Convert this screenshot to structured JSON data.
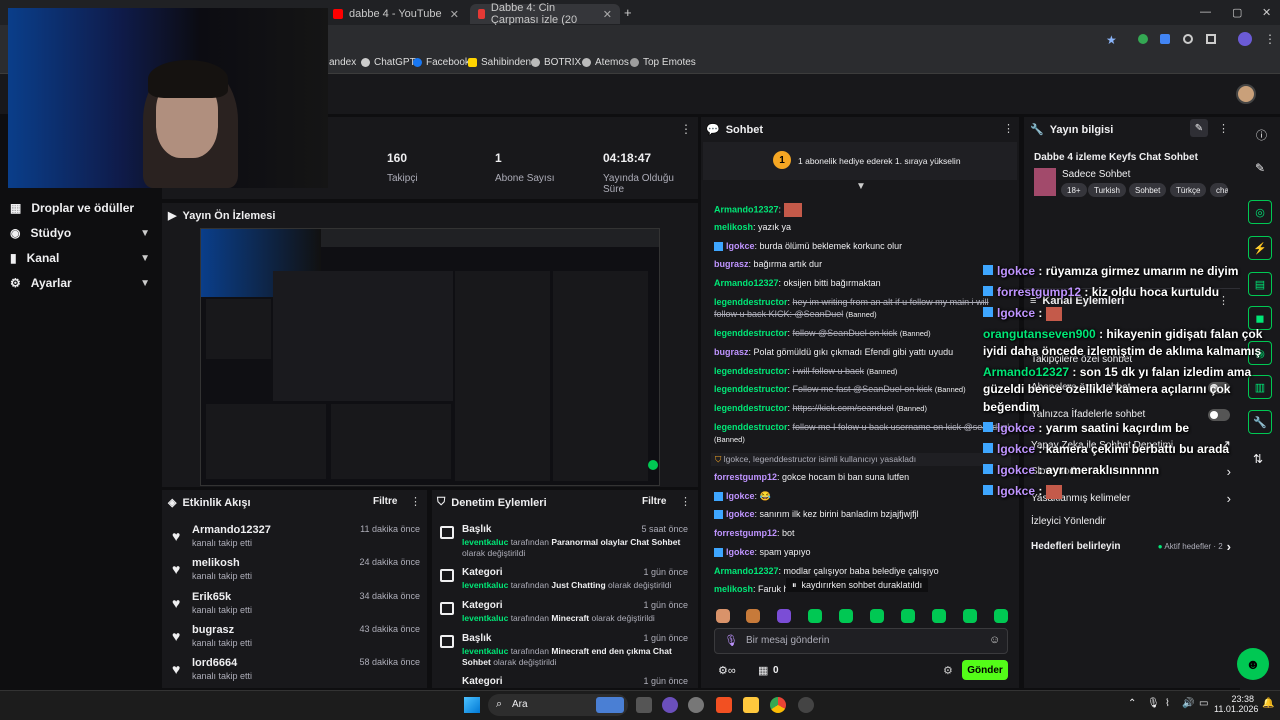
{
  "browser": {
    "tabs": [
      {
        "title": "dabbe 4 - YouTube",
        "color": "#ff0000"
      },
      {
        "title": "Dabbe 4: Cin Çarpması izle (20",
        "color": "#e53935"
      }
    ],
    "bookmarks": [
      "andex",
      "ChatGPT",
      "Facebook",
      "Sahibinden",
      "BOTRIX",
      "Atemos",
      "Top Emotes"
    ],
    "new_tab": "+"
  },
  "sidebar": {
    "items": [
      {
        "label": "Droplar ve ödüller",
        "icon": "gift-icon"
      },
      {
        "label": "Stüdyo",
        "icon": "studio-icon",
        "chevron": "▼"
      },
      {
        "label": "Kanal",
        "icon": "channel-icon",
        "chevron": "▼"
      },
      {
        "label": "Ayarlar",
        "icon": "gear-icon",
        "chevron": "▼"
      }
    ]
  },
  "stats": [
    {
      "value": "160",
      "label": "Takipçi"
    },
    {
      "value": "1",
      "label": "Abone Sayısı"
    },
    {
      "value": "04:18:47",
      "label": "Yayında Olduğu Süre"
    }
  ],
  "preview": {
    "title": "Yayın Ön İzlemesi"
  },
  "activity": {
    "title": "Etkinlik Akışı",
    "filter": "Filtre",
    "items": [
      {
        "name": "Armando12327",
        "action": "kanalı takip etti",
        "time": "11 dakika önce"
      },
      {
        "name": "melikosh",
        "action": "kanalı takip etti",
        "time": "24 dakika önce"
      },
      {
        "name": "Erik65k",
        "action": "kanalı takip etti",
        "time": "34 dakika önce"
      },
      {
        "name": "bugrasz",
        "action": "kanalı takip etti",
        "time": "43 dakika önce"
      },
      {
        "name": "lord6664",
        "action": "kanalı takip etti",
        "time": "58 dakika önce"
      }
    ]
  },
  "moderation": {
    "title": "Denetim Eylemleri",
    "filter": "Filtre",
    "items": [
      {
        "title": "Başlık",
        "time": "5 saat önce",
        "user": "leventkaluc",
        "mid": "tarafından",
        "value": "Paranormal olaylar Chat Sohbet",
        "suffix": "olarak değiştirildi"
      },
      {
        "title": "Kategori",
        "time": "1 gün önce",
        "user": "leventkaluc",
        "mid": "tarafından",
        "value": "Just Chatting",
        "suffix": "olarak değiştirildi"
      },
      {
        "title": "Kategori",
        "time": "1 gün önce",
        "user": "leventkaluc",
        "mid": "tarafından",
        "value": "Minecraft",
        "suffix": "olarak değiştirildi"
      },
      {
        "title": "Başlık",
        "time": "1 gün önce",
        "user": "leventkaluc",
        "mid": "tarafından",
        "value": "Minecraft end den çıkma Chat Sohbet",
        "suffix": "olarak değiştirildi"
      },
      {
        "title": "Kategori",
        "time": "1 gün önce",
        "user": "",
        "mid": "",
        "value": "",
        "suffix": ""
      }
    ]
  },
  "chat": {
    "title": "Sohbet",
    "gift_text": "1 abonelik hediye ederek 1. sıraya yükselin",
    "gift_badge": "1",
    "lines": [
      {
        "user": "Armando12327",
        "color": "#00e676",
        "text": "",
        "emote": true
      },
      {
        "user": "melikosh",
        "color": "#00e676",
        "text": "yazık ya"
      },
      {
        "user": "lgokce",
        "color": "#bf94ff",
        "text": "burda ölümü beklemek korkunc olur",
        "badge": true
      },
      {
        "user": "bugrasz",
        "color": "#bf94ff",
        "text": "bağırma artık dur"
      },
      {
        "user": "Armando12327",
        "color": "#00e676",
        "text": "oksijen bitti bağırmaktan"
      },
      {
        "user": "legenddestructor",
        "color": "#00e676",
        "text": "hey im writing from an alt if u follow my main i will follow u back KICK: @SeanDuel",
        "banned": "(Banned)",
        "strike": true
      },
      {
        "user": "legenddestructor",
        "color": "#00e676",
        "text": "follow @SeanDuel on kick",
        "banned": "(Banned)",
        "strike": true
      },
      {
        "user": "bugrasz",
        "color": "#bf94ff",
        "text": "Polat gömüldü gıkı çıkmadı Efendi gibi yattı uyudu"
      },
      {
        "user": "legenddestructor",
        "color": "#00e676",
        "text": "i will follow u back",
        "banned": "(Banned)",
        "strike": true
      },
      {
        "user": "legenddestructor",
        "color": "#00e676",
        "text": "Follow me fast @SeanDuel on kick",
        "banned": "(Banned)",
        "strike": true
      },
      {
        "user": "legenddestructor",
        "color": "#00e676",
        "text": "https://kick.com/seanduel",
        "banned": "(Banned)",
        "strike": true
      },
      {
        "user": "legenddestructor",
        "color": "#00e676",
        "text": "follow me I folow u back username on kick @seanduel",
        "banned": "(Banned)",
        "strike": true
      }
    ],
    "system": "lgokce, legenddestructor isimli kullanıcıyı yasakladı",
    "lines2": [
      {
        "user": "forrestgump12",
        "color": "#bf94ff",
        "text": "gokce hocam bi ban suna lutfen"
      },
      {
        "user": "lgokce",
        "color": "#bf94ff",
        "text": "😂",
        "badge": true
      },
      {
        "user": "lgokce",
        "color": "#bf94ff",
        "text": "sanırım ilk kez birini banladım bzjajfjwjfjl",
        "badge": true
      },
      {
        "user": "forrestgump12",
        "color": "#bf94ff",
        "text": "bot"
      },
      {
        "user": "lgokce",
        "color": "#bf94ff",
        "text": "spam yapıyo",
        "badge": true
      },
      {
        "user": "Armando12327",
        "color": "#00e676",
        "text": "modlar çalışıyor baba belediye çalışıyo"
      },
      {
        "user": "melikosh",
        "color": "#00e676",
        "text": "Faruk h"
      }
    ],
    "paused": "kaydırırken sohbet duraklatıldı",
    "input_placeholder": "Bir mesaj gönderin",
    "points": "0",
    "send": "Gönder"
  },
  "stream_info": {
    "title": "Yayın bilgisi",
    "stream_title": "Dabbe 4 izleme Keyfs Chat Sohbet",
    "category": "Sadece Sohbet",
    "tags": [
      "18+",
      "Turkish",
      "Sohbet",
      "Türkçe",
      "cha"
    ],
    "channel_actions": "Kanal Eylemleri",
    "items": [
      {
        "label": "Takipçilere özel sohbet",
        "toggle": false
      },
      {
        "label": "Abonelere özel sohbet",
        "toggle": false
      },
      {
        "label": "Yalnızca İfadelerle sohbet",
        "toggle": false
      },
      {
        "label": "Yapay Zeka ile Sohbet Denetimi",
        "arrow": "↗"
      },
      {
        "label": "Slow mode",
        "arrow": "›"
      },
      {
        "label": "Yasaklanmış kelimeler",
        "arrow": "›"
      },
      {
        "label": "İzleyici Yönlendir",
        "arrow": ""
      },
      {
        "label": "Hedefleri belirleyin",
        "arrow": "›",
        "extra": "Aktif hedefler · 2"
      }
    ]
  },
  "overlay_chat": [
    {
      "user": "lgokce",
      "text": ": rüyamıza girmez umarım ne diyim",
      "color": "#bf94ff"
    },
    {
      "user": "forrestgump12",
      "text": ": kiz oldu hoca kurtuldu",
      "color": "#bf94ff"
    },
    {
      "user": "lgokce",
      "text": ":",
      "color": "#bf94ff"
    },
    {
      "user": "orangutanseven900",
      "text": ": hikayenin gidişatı falan çok",
      "color": "#00e676"
    },
    {
      "user": "",
      "text": "iyidi daha öncede izlemiştim de aklıma kalmamış",
      "color": "#fff"
    },
    {
      "user": "Armando12327",
      "text": ": son 15 dk yı falan izledim ama",
      "color": "#00e676"
    },
    {
      "user": "",
      "text": "güzeldi bence özellikle kamera açılarını çok",
      "color": "#fff"
    },
    {
      "user": "",
      "text": "beğendim",
      "color": "#fff"
    },
    {
      "user": "lgokce",
      "text": ": yarım saatini kaçırdım be",
      "color": "#bf94ff"
    },
    {
      "user": "lgokce",
      "text": ": kamera çekimi berbattı bu arada",
      "color": "#bf94ff"
    },
    {
      "user": "lgokce",
      "text": ": ayrı meraklısınnnnn",
      "color": "#bf94ff"
    },
    {
      "user": "lgokce",
      "text": ":",
      "color": "#bf94ff"
    }
  ],
  "taskbar": {
    "search": "Ara",
    "time": "23:38",
    "date": "11.01.2026"
  }
}
